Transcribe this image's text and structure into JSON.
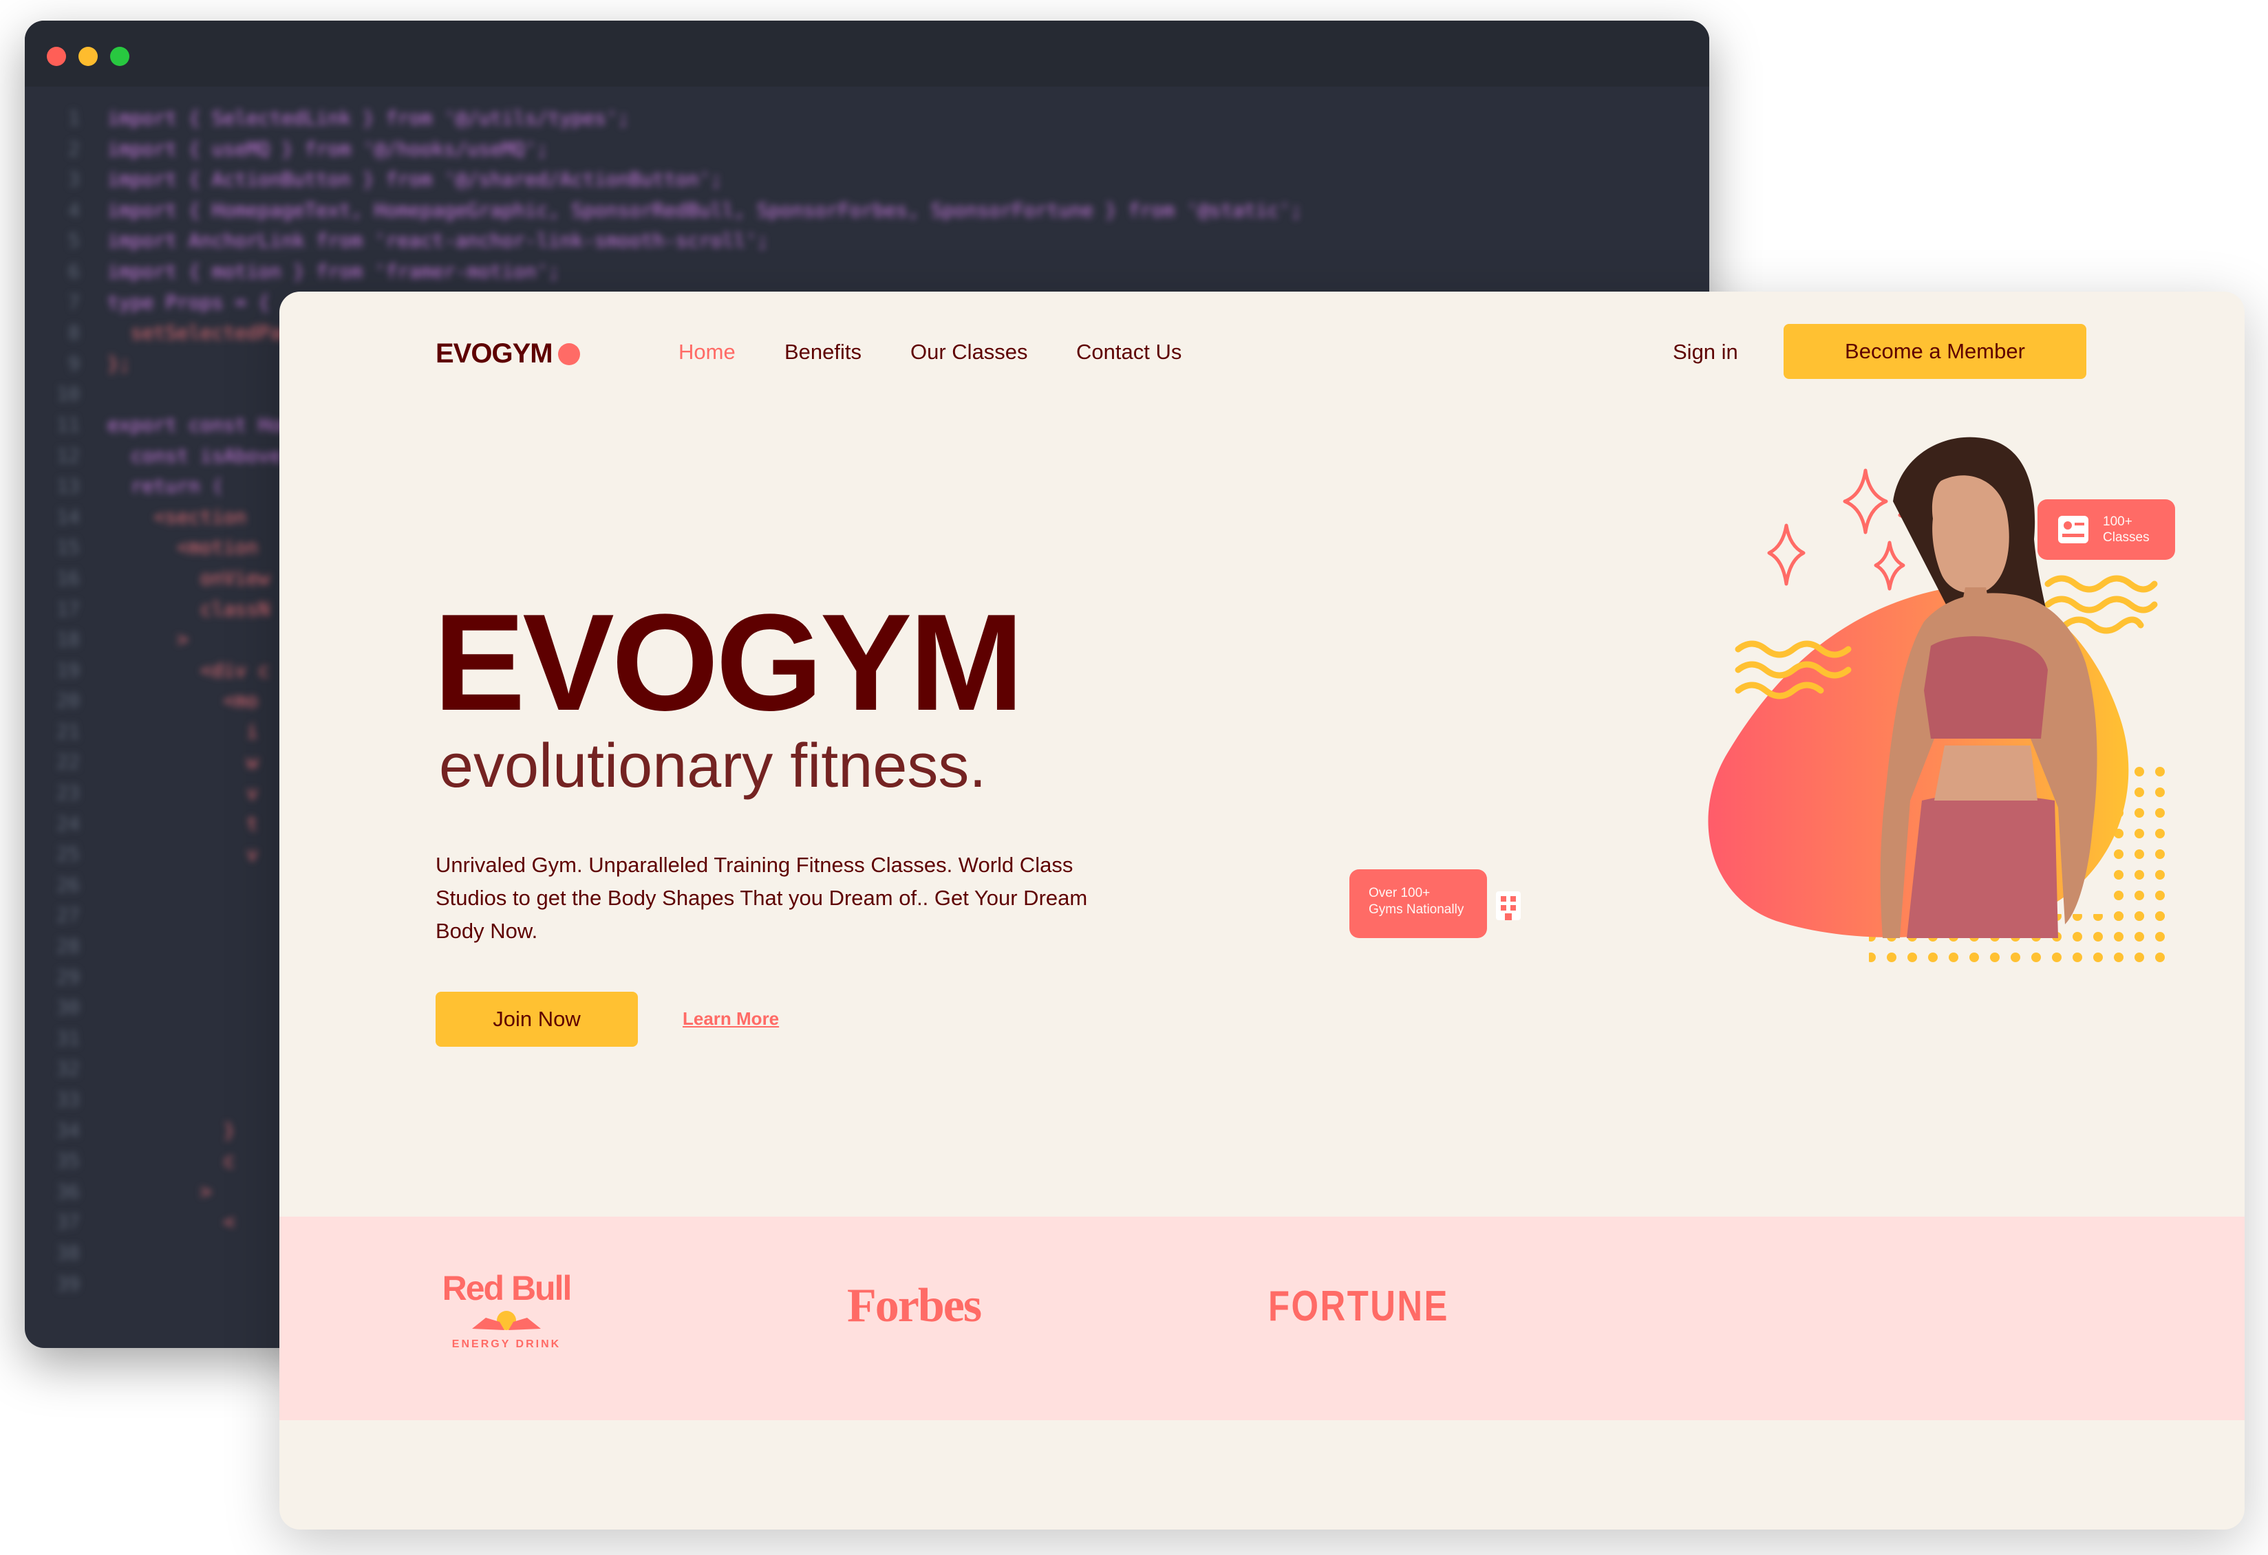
{
  "colors": {
    "primary": "#5e0000",
    "accent": "#ff6b66",
    "yellow": "#ffc132",
    "background": "#f7f2ea",
    "sponsor_band": "#ffe0de",
    "editor_bg": "#2b2f3b"
  },
  "editor": {
    "lines": [
      {
        "n": "1",
        "text": "import { SelectedLink } from '@/utils/types';"
      },
      {
        "n": "2",
        "text": "import { useMQ } from '@/hooks/useMQ';"
      },
      {
        "n": "3",
        "text": "import { ActionButton } from '@/shared/ActionButton';"
      },
      {
        "n": "4",
        "text": "import { HomepageText, HomepageGraphic, SponsorRedBull, SponsorForbes, SponsorFortune } from '@static';"
      },
      {
        "n": "5",
        "text": "import AnchorLink from 'react-anchor-link-smooth-scroll';"
      },
      {
        "n": "6",
        "text": "import { motion } from 'framer-motion';"
      },
      {
        "n": "7",
        "text": "type Props = {"
      },
      {
        "n": "8",
        "text": "  setSelectedPage"
      },
      {
        "n": "9",
        "text": "};"
      },
      {
        "n": "10",
        "text": ""
      },
      {
        "n": "11",
        "text": "export const Home"
      },
      {
        "n": "12",
        "text": "  const isAbove"
      },
      {
        "n": "13",
        "text": "  return ("
      },
      {
        "n": "14",
        "text": "    <section"
      },
      {
        "n": "15",
        "text": "      <motion"
      },
      {
        "n": "16",
        "text": "        onView"
      },
      {
        "n": "17",
        "text": "        classN"
      },
      {
        "n": "18",
        "text": "      >"
      },
      {
        "n": "19",
        "text": "        <div c"
      },
      {
        "n": "20",
        "text": "          <mo"
      },
      {
        "n": "21",
        "text": "            i"
      },
      {
        "n": "22",
        "text": "            w"
      },
      {
        "n": "23",
        "text": "            v"
      },
      {
        "n": "24",
        "text": "            t"
      },
      {
        "n": "25",
        "text": "            v"
      },
      {
        "n": "26",
        "text": ""
      },
      {
        "n": "27",
        "text": ""
      },
      {
        "n": "28",
        "text": ""
      },
      {
        "n": "29",
        "text": ""
      },
      {
        "n": "30",
        "text": ""
      },
      {
        "n": "31",
        "text": ""
      },
      {
        "n": "32",
        "text": ""
      },
      {
        "n": "33",
        "text": ""
      },
      {
        "n": "34",
        "text": "          }"
      },
      {
        "n": "35",
        "text": "          c"
      },
      {
        "n": "36",
        "text": "        >"
      },
      {
        "n": "37",
        "text": "          <"
      },
      {
        "n": "38",
        "text": ""
      },
      {
        "n": "39",
        "text": ""
      }
    ]
  },
  "site": {
    "logo": "EVOGYM",
    "nav": [
      {
        "label": "Home",
        "active": true
      },
      {
        "label": "Benefits",
        "active": false
      },
      {
        "label": "Our Classes",
        "active": false
      },
      {
        "label": "Contact Us",
        "active": false
      }
    ],
    "signin_label": "Sign in",
    "member_button": "Become a Member",
    "hero": {
      "title": "EVOGYM",
      "subtitle": "evolutionary fitness.",
      "text": "Unrivaled Gym. Unparalleled Training Fitness Classes. World Class Studios to get the Body Shapes That you Dream of.. Get Your Dream Body Now.",
      "join_button": "Join Now",
      "learn_link": "Learn More"
    },
    "badges": {
      "classes_count": "100+",
      "classes_label": "Classes",
      "gyms_line1": "Over 100+",
      "gyms_line2": "Gyms Nationally"
    },
    "sponsors": {
      "redbull": "Red Bull",
      "redbull_sub": "ENERGY DRINK",
      "forbes": "Forbes",
      "fortune": "FORTUNE"
    }
  }
}
